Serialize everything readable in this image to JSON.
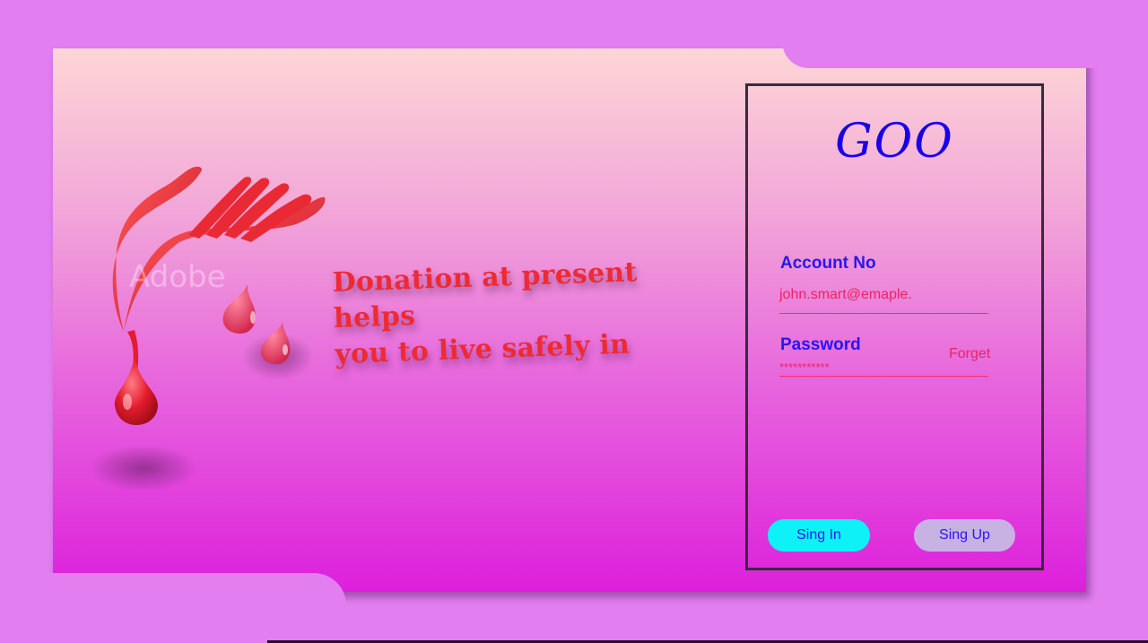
{
  "hero": {
    "logo_icon": "hand-blood-drop-icon",
    "watermark": "Adobe",
    "tagline_line1": "Donation at present  helps",
    "tagline_line2": "you to live safely in"
  },
  "login": {
    "brand": "GOO",
    "account_label": "Account  No",
    "account_value": "john.smart@emaple.",
    "password_label": "Password",
    "password_value": "***********",
    "forget_label": "Forget",
    "signin_label": "Sing In",
    "signup_label": "Sing Up"
  },
  "colors": {
    "page_bg": "#e27ef0",
    "accent_red": "#ee2b33",
    "label_blue": "#2a16ec",
    "signin_bg": "#0ef2f7",
    "signup_bg": "#c8b2e4"
  }
}
